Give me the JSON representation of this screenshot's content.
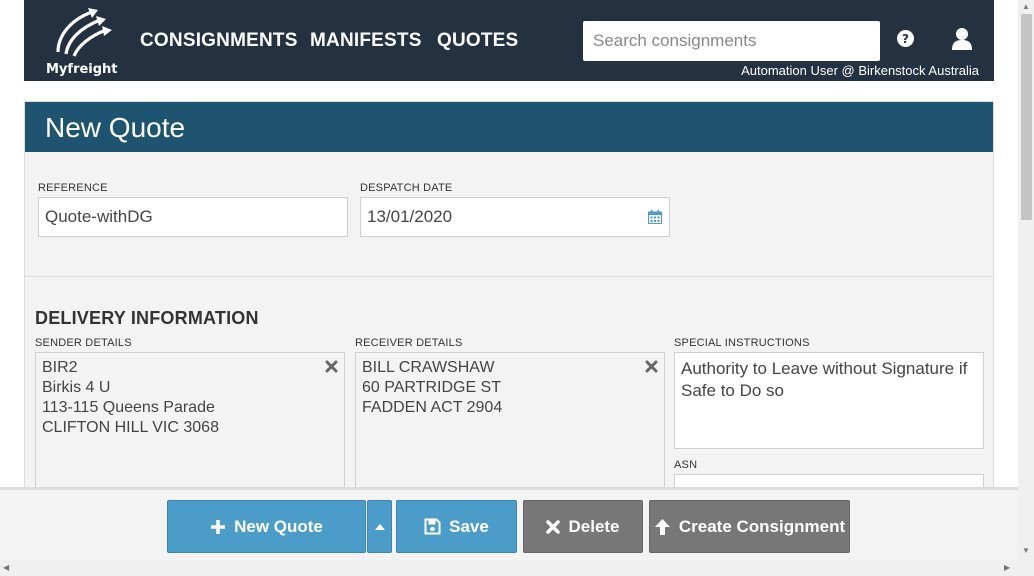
{
  "nav": {
    "brand": "Myfreight",
    "items": [
      "CONSIGNMENTS",
      "MANIFESTS",
      "QUOTES"
    ],
    "search_placeholder": "Search consignments",
    "user_line": "Automation User @ Birkenstock Australia"
  },
  "page": {
    "title": "New Quote"
  },
  "form": {
    "reference_label": "REFERENCE",
    "reference_value": "Quote-withDG",
    "despatch_label": "DESPATCH DATE",
    "despatch_value": "13/01/2020"
  },
  "delivery": {
    "section_title": "DELIVERY INFORMATION",
    "sender_label": "SENDER DETAILS",
    "sender_lines": [
      "BIR2",
      "Birkis 4 U",
      "113-115 Queens Parade",
      "CLIFTON HILL VIC 3068"
    ],
    "receiver_label": "RECEIVER DETAILS",
    "receiver_lines": [
      "BILL CRAWSHAW",
      "60 PARTRIDGE ST",
      "FADDEN ACT 2904"
    ],
    "special_label": "SPECIAL INSTRUCTIONS",
    "special_value": "Authority to Leave without Signature if Safe to Do so",
    "asn_label": "ASN"
  },
  "actions": {
    "new_quote": "New Quote",
    "save": "Save",
    "delete": "Delete",
    "create_consignment": "Create Consignment"
  },
  "colors": {
    "navbar": "#243140",
    "header": "#1e5470",
    "primary_button": "#4b9cc8",
    "secondary_button": "#777777"
  }
}
